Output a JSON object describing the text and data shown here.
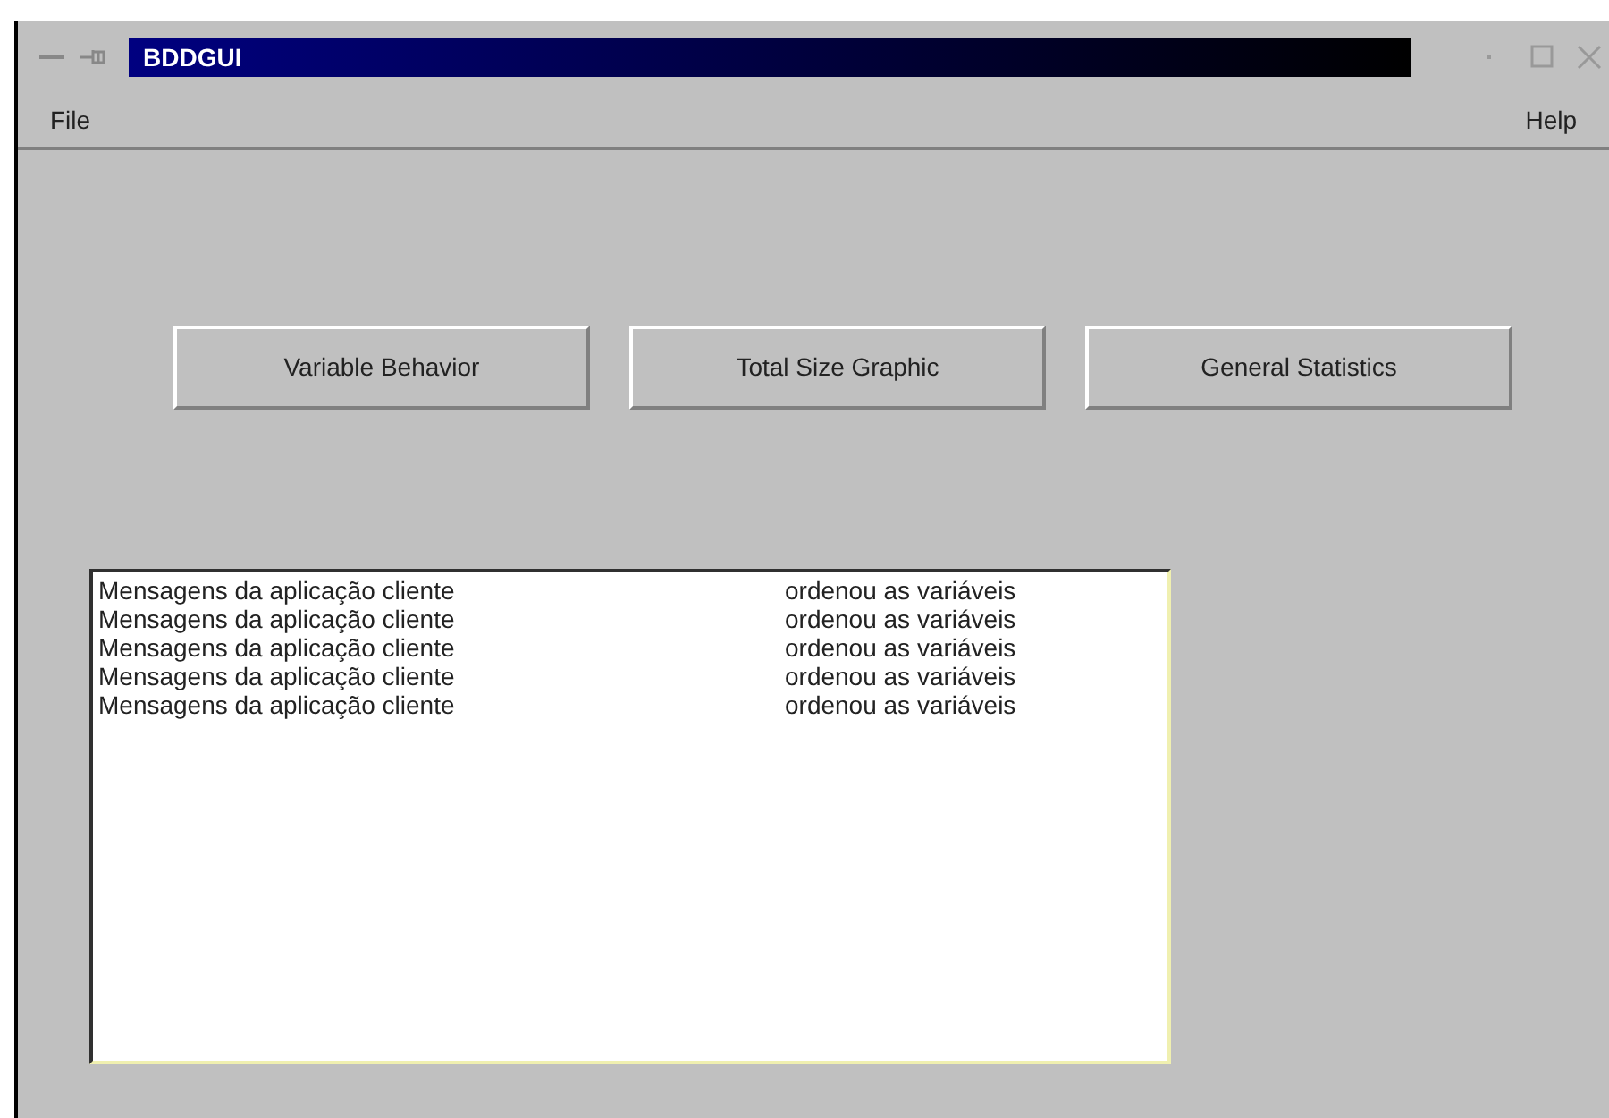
{
  "window": {
    "title": "BDDGUI"
  },
  "menu": [
    {
      "label": "File"
    },
    {
      "label": "Help"
    }
  ],
  "buttons": [
    {
      "label": "Variable Behavior"
    },
    {
      "label": "Total Size Graphic"
    },
    {
      "label": "General Statistics"
    }
  ],
  "messages": [
    {
      "text": "Mensagens da aplicação cliente",
      "status": "ordenou as variáveis"
    },
    {
      "text": "Mensagens da aplicação cliente",
      "status": "ordenou as variáveis"
    },
    {
      "text": "Mensagens da aplicação cliente",
      "status": "ordenou as variáveis"
    },
    {
      "text": "Mensagens da aplicação cliente",
      "status": "ordenou as variáveis"
    },
    {
      "text": "Mensagens da aplicação cliente",
      "status": "ordenou as variáveis"
    }
  ]
}
